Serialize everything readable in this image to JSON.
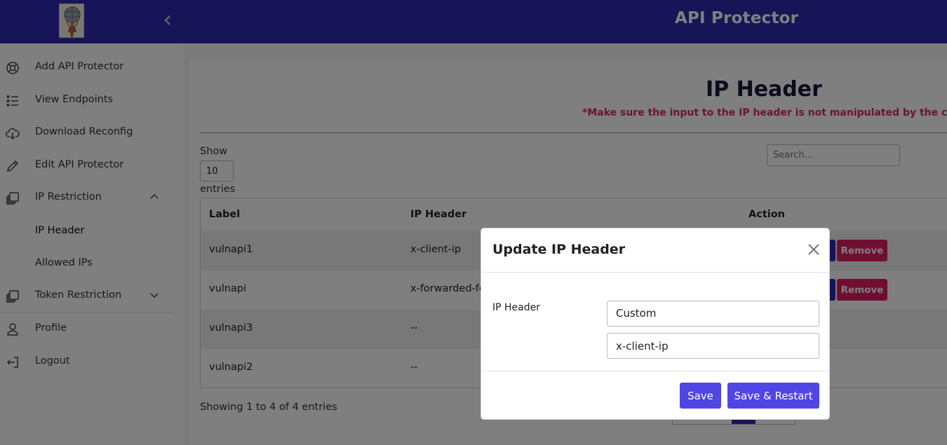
{
  "header": {
    "app_title": "API Protector"
  },
  "sidebar": {
    "items": [
      {
        "label": "Add API Protector",
        "icon": "lifebuoy-icon"
      },
      {
        "label": "View Endpoints",
        "icon": "list-icon"
      },
      {
        "label": "Download Reconfig",
        "icon": "cloud-download-icon"
      },
      {
        "label": "Edit API Protector",
        "icon": "pencil-icon"
      },
      {
        "label": "IP Restriction",
        "icon": "stack-icon",
        "expanded": true,
        "children": [
          {
            "label": "IP Header",
            "active": true
          },
          {
            "label": "Allowed IPs"
          }
        ]
      },
      {
        "label": "Token Restriction",
        "icon": "stack-icon",
        "expanded": false
      },
      {
        "label": "Profile",
        "icon": "person-icon"
      },
      {
        "label": "Logout",
        "icon": "logout-icon"
      }
    ]
  },
  "main": {
    "title": "IP Header",
    "warning": "*Make sure the input to the IP header is not manipulated by the client.",
    "show_label": "Show",
    "page_length": "10",
    "entries_label": "entries",
    "search_placeholder": "Search...",
    "table": {
      "columns": [
        "Label",
        "IP Header",
        "Action"
      ],
      "rows": [
        {
          "label": "vulnapi1",
          "ip_header": "x-client-ip",
          "has_remove": true
        },
        {
          "label": "vulnapi",
          "ip_header": "x-forwarded-fo",
          "has_remove": true
        },
        {
          "label": "vulnapi3",
          "ip_header": "--",
          "has_remove": false
        },
        {
          "label": "vulnapi2",
          "ip_header": "--",
          "has_remove": false
        }
      ],
      "remove_label": "Remove"
    },
    "info": "Showing 1 to 4 of 4 entries"
  },
  "modal": {
    "title": "Update IP Header",
    "field_label": "IP Header",
    "select_value": "Custom",
    "input_value": "x-client-ip",
    "save_label": "Save",
    "save_restart_label": "Save & Restart"
  },
  "colors": {
    "topbar": "#2f2bb0",
    "warning": "#e0245e",
    "remove_button": "#e11d63",
    "primary_button": "#4f46e5"
  }
}
